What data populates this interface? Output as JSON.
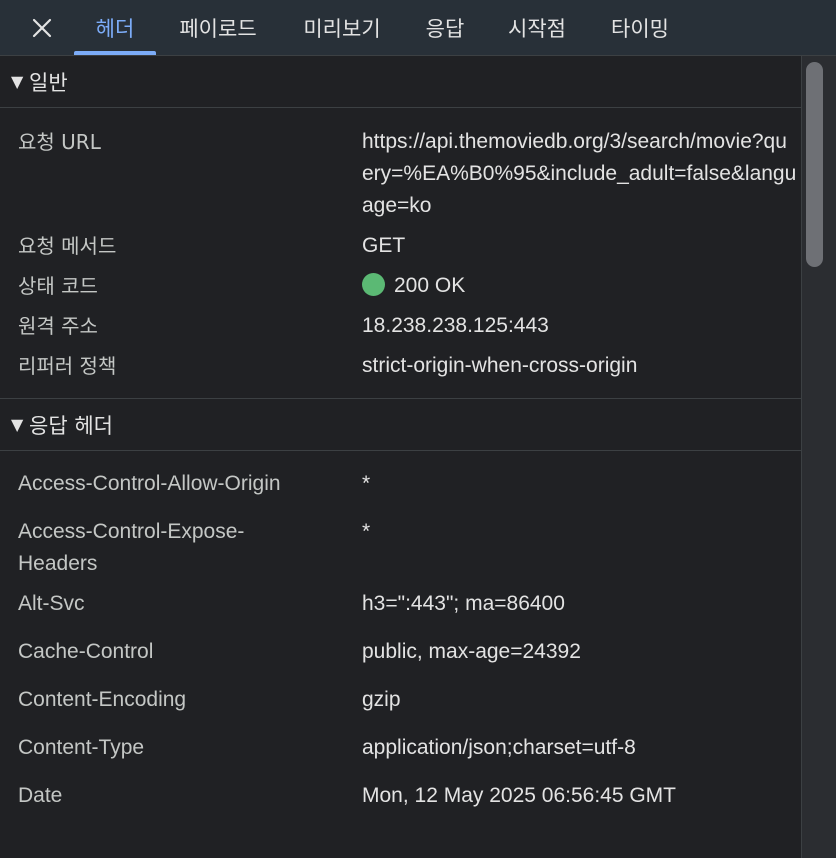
{
  "tabs": [
    {
      "label": "헤더",
      "active": true
    },
    {
      "label": "페이로드",
      "active": false
    },
    {
      "label": "미리보기",
      "active": false
    },
    {
      "label": "응답",
      "active": false
    },
    {
      "label": "시작점",
      "active": false
    },
    {
      "label": "타이밍",
      "active": false
    }
  ],
  "close_icon": "close-icon",
  "general": {
    "title": "일반",
    "rows": [
      {
        "key": "요청 URL",
        "value": "https://api.themoviedb.org/3/search/movie?query=%EA%B0%95&include_adult=false&language=ko"
      },
      {
        "key": "요청 메서드",
        "value": "GET"
      },
      {
        "key": "상태 코드",
        "value": "200 OK",
        "status_color": "#5bb974"
      },
      {
        "key": "원격 주소",
        "value": "18.238.238.125:443"
      },
      {
        "key": "리퍼러 정책",
        "value": "strict-origin-when-cross-origin"
      }
    ]
  },
  "response_headers": {
    "title": "응답 헤더",
    "rows": [
      {
        "key": "Access-Control-Allow-Origin",
        "value": "*"
      },
      {
        "key": "Access-Control-Expose-Headers",
        "value": "*"
      },
      {
        "key": "Alt-Svc",
        "value": "h3=\":443\"; ma=86400"
      },
      {
        "key": "Cache-Control",
        "value": "public, max-age=24392"
      },
      {
        "key": "Content-Encoding",
        "value": "gzip"
      },
      {
        "key": "Content-Type",
        "value": "application/json;charset=utf-8"
      },
      {
        "key": "Date",
        "value": "Mon, 12 May 2025 06:56:45 GMT"
      }
    ]
  },
  "colors": {
    "accent": "#7cacf8",
    "background": "#202124",
    "tabbar": "#283038",
    "status_ok": "#5bb974"
  }
}
